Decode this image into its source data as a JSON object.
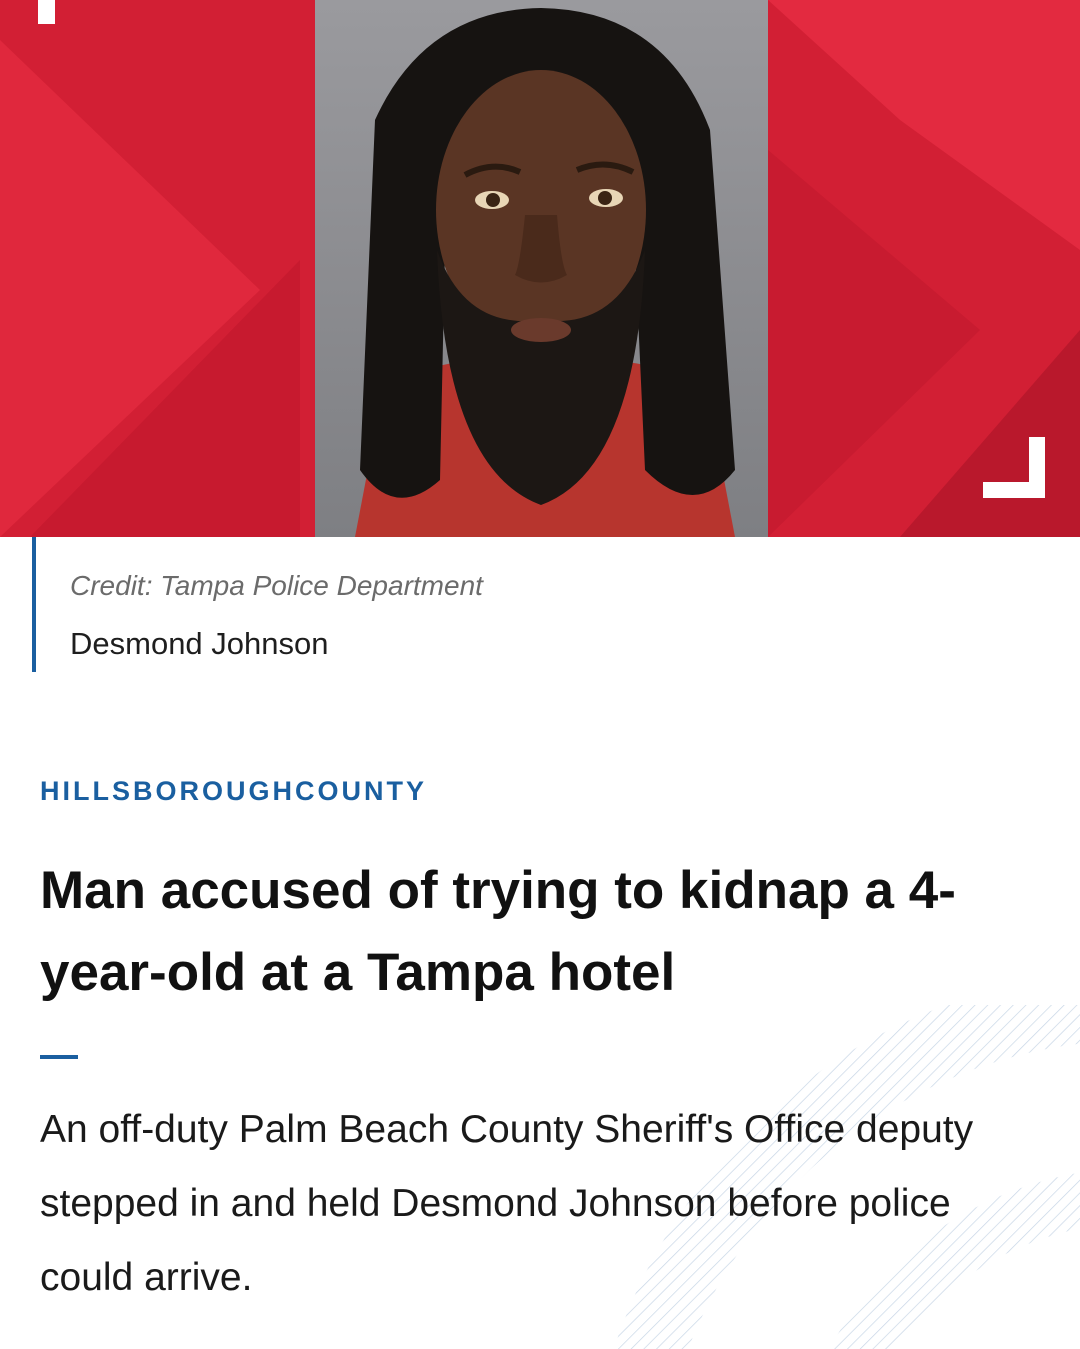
{
  "photo": {
    "credit": "Credit: Tampa Police Department",
    "name": "Desmond Johnson"
  },
  "article": {
    "category": "HILLSBOROUGHCOUNTY",
    "headline": "Man accused of trying to kidnap a 4-year-old at a Tampa hotel",
    "summary": "An off-duty Palm Beach County Sheriff's Office deputy stepped in and held Desmond Johnson before police could arrive."
  },
  "colors": {
    "brand_red": "#d21f34",
    "accent_blue": "#1a5fa0"
  }
}
